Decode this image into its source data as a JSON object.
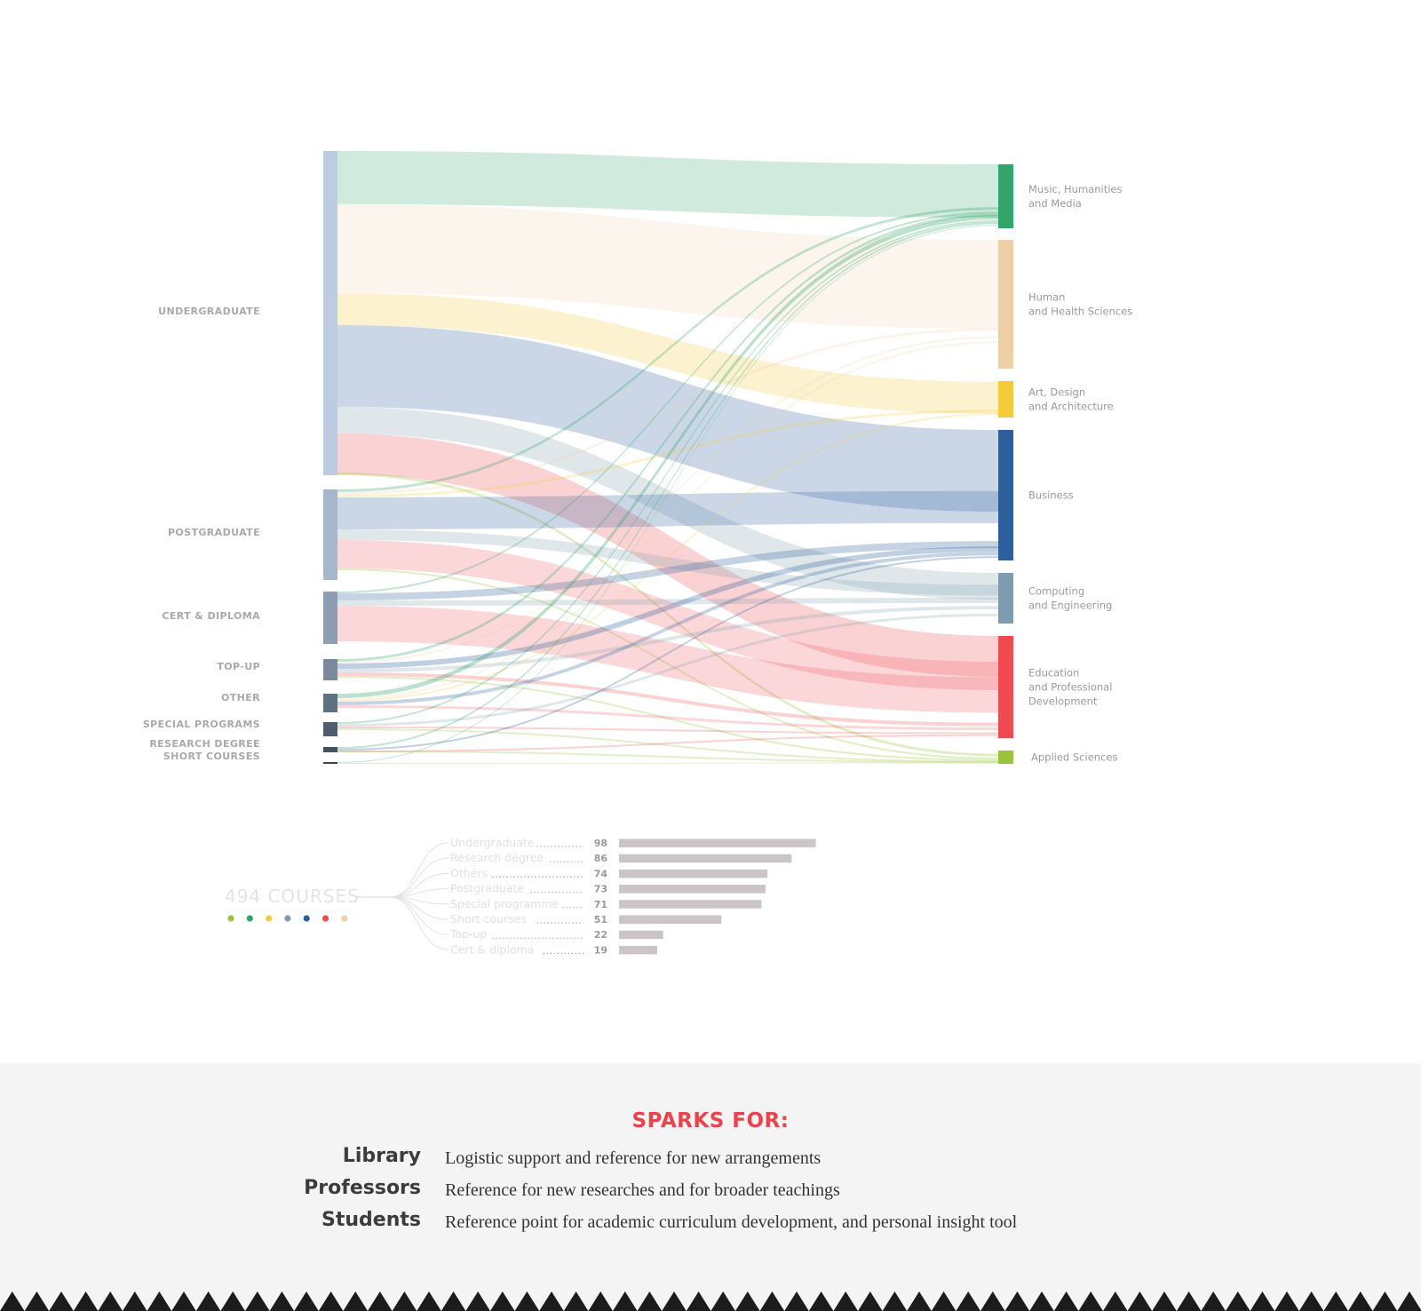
{
  "chart_data": [
    {
      "type": "sankey",
      "title": "",
      "sources": [
        {
          "name": "UNDERGRADUATE",
          "color": "#bdcce0",
          "value": 98
        },
        {
          "name": "POSTGRADUATE",
          "color": "#a6b6cb",
          "value": 73
        },
        {
          "name": "CERT & DIPLOMA",
          "color": "#8e9db2",
          "value": 19
        },
        {
          "name": "TOP-UP",
          "color": "#7a8a9c",
          "value": 22
        },
        {
          "name": "OTHER",
          "color": "#5f7082",
          "value": 74
        },
        {
          "name": "SPECIAL PROGRAMS",
          "color": "#4f5e6e",
          "value": 71
        },
        {
          "name": "RESEARCH DEGREE",
          "color": "#44515f",
          "value": 86
        },
        {
          "name": "SHORT COURSES",
          "color": "#3a4653",
          "value": 51
        }
      ],
      "targets": [
        {
          "name": "Music, Humanities\nand Media",
          "color": "#35a46b"
        },
        {
          "name": "Human\nand Health Sciences",
          "color": "#eecfa6"
        },
        {
          "name": "Art, Design\nand Architecture",
          "color": "#f4cb3d"
        },
        {
          "name": "Business",
          "color": "#2d5f9c"
        },
        {
          "name": "Computing\nand Engineering",
          "color": "#7e9cb0"
        },
        {
          "name": "Education\nand Professional\nDevelopment",
          "color": "#ee4a50"
        },
        {
          "name": "Applied Sciences",
          "color": "#9ac43d"
        }
      ]
    },
    {
      "type": "bar",
      "orientation": "horizontal",
      "total_label": "494 COURSES",
      "categories": [
        "Undergraduate",
        "Research degree",
        "Others",
        "Postgraduate",
        "Special programme",
        "Short courses",
        "Top-up",
        "Cert & diploma"
      ],
      "values": [
        98,
        86,
        74,
        73,
        71,
        51,
        22,
        19
      ],
      "bar_color": "#cbc5c8",
      "legend_dots": [
        "#9ac43d",
        "#35a46b",
        "#f4cb3d",
        "#7e9cb0",
        "#2d5f9c",
        "#ee4a50",
        "#eecfa6"
      ]
    }
  ],
  "footer": {
    "title": "SPARKS FOR:",
    "rows": [
      {
        "role": "Library",
        "desc": "Logistic support and reference for new arrangements"
      },
      {
        "role": "Professors",
        "desc": "Reference for new researches and for broader teachings"
      },
      {
        "role": "Students",
        "desc": "Reference point for academic curriculum development, and personal insight tool"
      }
    ]
  }
}
